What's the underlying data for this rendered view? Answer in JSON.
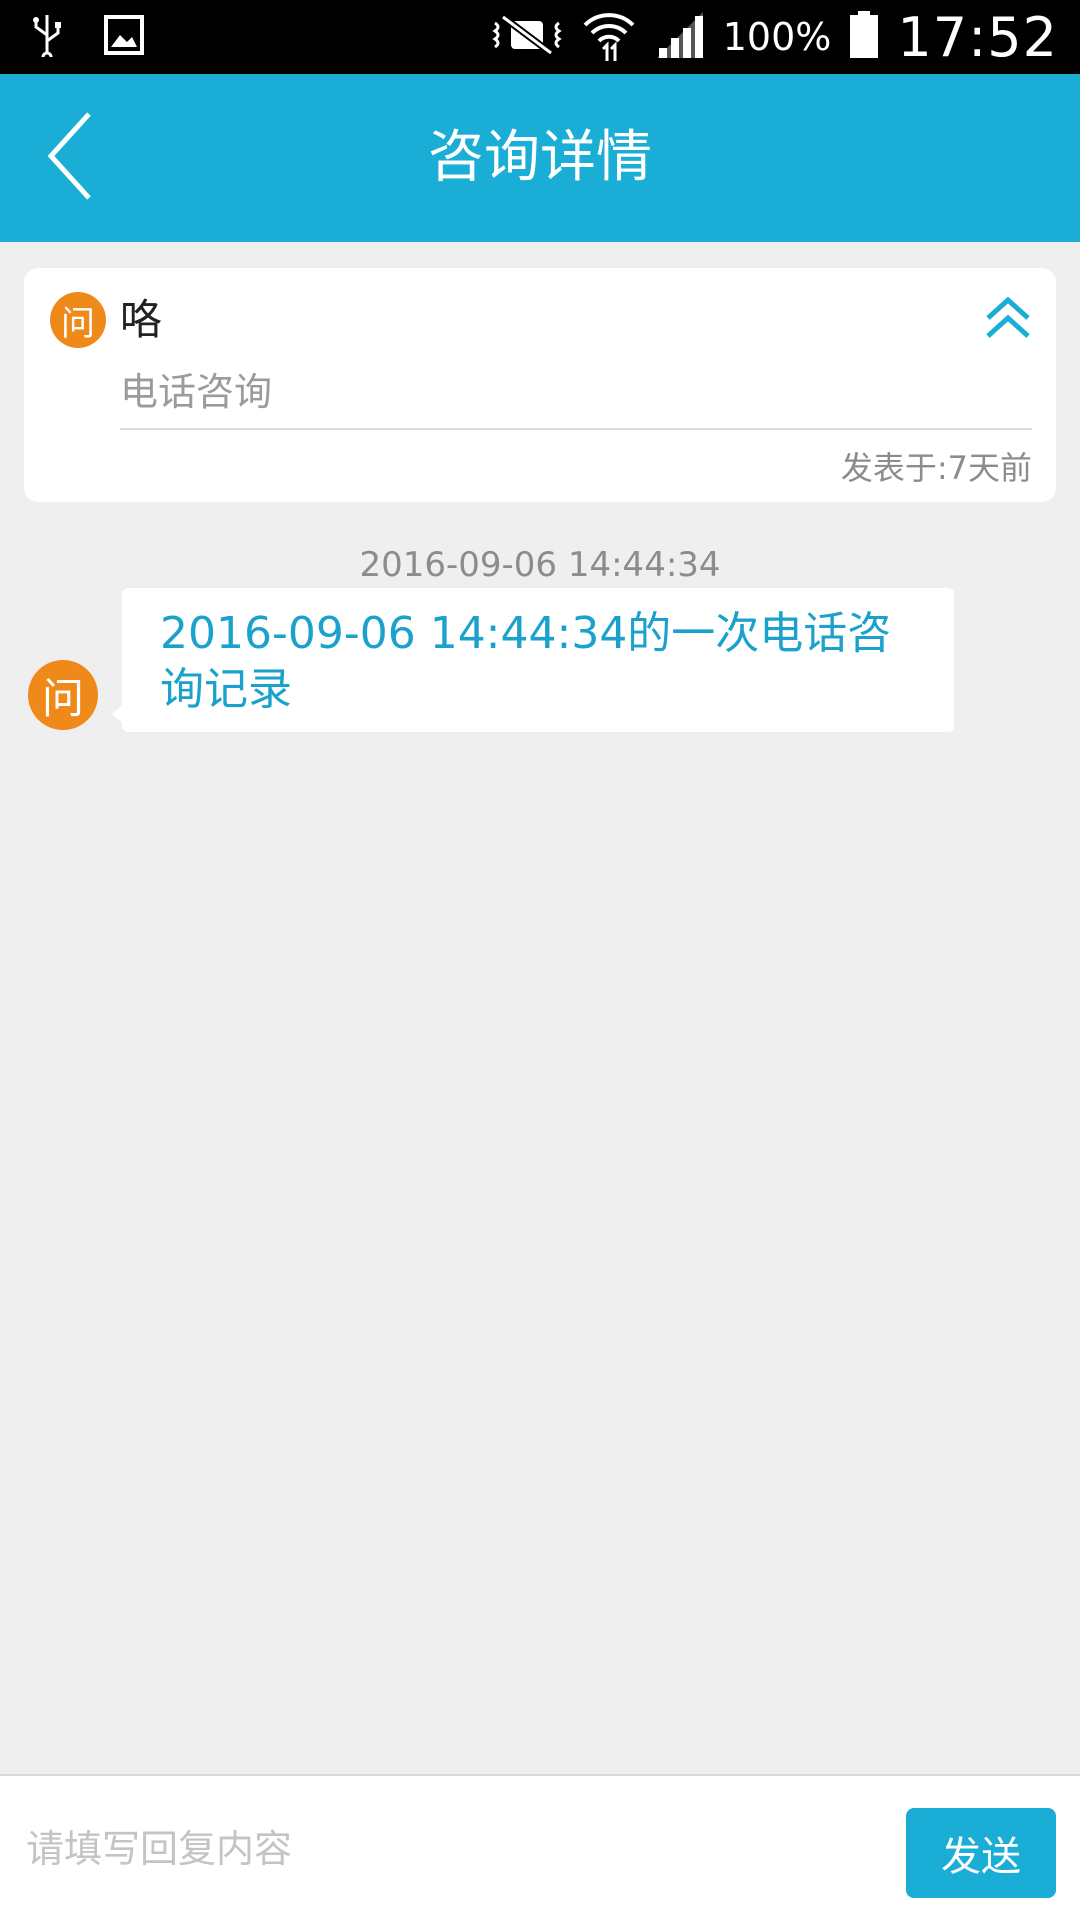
{
  "status_bar": {
    "battery_percent": "100%",
    "time": "17:52",
    "icons": [
      "usb-icon",
      "image-icon",
      "mute-icon",
      "wifi-icon",
      "signal-icon",
      "battery-icon"
    ]
  },
  "header": {
    "title": "咨询详情",
    "accent_color": "#1aaed6"
  },
  "question": {
    "badge": "问",
    "title": "咯",
    "type": "电话咨询",
    "posted": "发表于:7天前",
    "badge_color": "#ef8a1a"
  },
  "messages": [
    {
      "time": "2016-09-06 14:44:34",
      "badge": "问",
      "text": "2016-09-06 14:44:34的一次电话咨询记录"
    }
  ],
  "reply": {
    "placeholder": "请填写回复内容",
    "send_label": "发送"
  }
}
